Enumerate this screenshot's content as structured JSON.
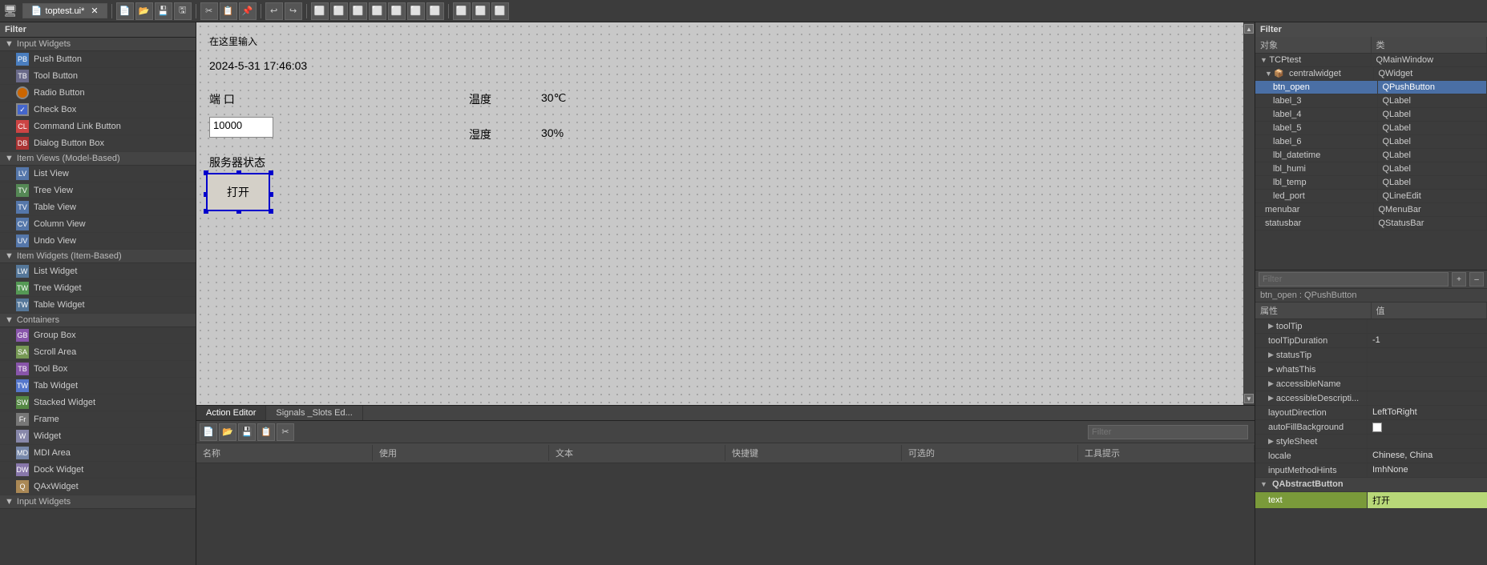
{
  "window": {
    "title": "toptest.ui*",
    "tab_label": "toptest.ui*"
  },
  "toolbar": {
    "buttons": [
      "new",
      "open",
      "save",
      "save-as",
      "cut",
      "copy",
      "paste",
      "undo",
      "redo",
      "align-left",
      "align-center",
      "align-right",
      "grid",
      "layout-h",
      "layout-v",
      "layout-grid",
      "form",
      "break-layout",
      "adjust-size",
      "tab-order",
      "buddies",
      "signals"
    ]
  },
  "left_panel": {
    "header": "Filter",
    "sections": [
      {
        "label": "Input Widgets",
        "items": [
          {
            "label": "Push Button",
            "icon": "btn"
          },
          {
            "label": "Tool Button",
            "icon": "tool"
          },
          {
            "label": "Radio Button",
            "icon": "radio"
          },
          {
            "label": "Check Box",
            "icon": "check"
          },
          {
            "label": "Command Link Button",
            "icon": "cmd"
          },
          {
            "label": "Dialog Button Box",
            "icon": "dialog"
          }
        ]
      },
      {
        "label": "Item Views (Model-Based)",
        "items": [
          {
            "label": "List View",
            "icon": "list"
          },
          {
            "label": "Tree View",
            "icon": "tree"
          },
          {
            "label": "Table View",
            "icon": "table"
          },
          {
            "label": "Column View",
            "icon": "col"
          },
          {
            "label": "Undo View",
            "icon": "undo"
          }
        ]
      },
      {
        "label": "Item Widgets (Item-Based)",
        "items": [
          {
            "label": "List Widget",
            "icon": "list"
          },
          {
            "label": "Tree Widget",
            "icon": "tree"
          },
          {
            "label": "Table Widget",
            "icon": "table"
          }
        ]
      },
      {
        "label": "Containers",
        "items": [
          {
            "label": "Group Box",
            "icon": "group"
          },
          {
            "label": "Scroll Area",
            "icon": "scroll"
          },
          {
            "label": "Tool Box",
            "icon": "toolbox"
          },
          {
            "label": "Tab Widget",
            "icon": "tab"
          },
          {
            "label": "Stacked Widget",
            "icon": "stacked"
          },
          {
            "label": "Frame",
            "icon": "frame"
          },
          {
            "label": "Widget",
            "icon": "widget"
          },
          {
            "label": "MDI Area",
            "icon": "mdi"
          },
          {
            "label": "Dock Widget",
            "icon": "dock"
          },
          {
            "label": "QAxWidget",
            "icon": "qax"
          }
        ]
      },
      {
        "label": "Input Widgets",
        "items": []
      }
    ]
  },
  "canvas": {
    "placeholder_text": "在这里输入",
    "datetime_text": "2024-5-31  17:46:03",
    "port_label": "端  口",
    "temp_label": "温度",
    "temp_value": "30℃",
    "humi_label": "湿度",
    "humi_value": "30%",
    "port_input": "10000",
    "server_label": "服务器状态",
    "btn_open_label": "打开"
  },
  "bottom_panel": {
    "tabs": [
      "Action Editor",
      "Signals _Slots Ed..."
    ],
    "active_tab": "Action Editor",
    "filter_placeholder": "Filter",
    "columns": [
      "名称",
      "使用",
      "文本",
      "快捷键",
      "可选的",
      "工具提示"
    ]
  },
  "right_object_tree": {
    "header": "Filter",
    "columns": [
      "对象",
      "类"
    ],
    "rows": [
      {
        "indent": 0,
        "expand": true,
        "name": "TCPtest",
        "cls": "QMainWindow",
        "selected": false
      },
      {
        "indent": 1,
        "expand": true,
        "name": "centralwidget",
        "cls": "QWidget",
        "selected": false
      },
      {
        "indent": 2,
        "expand": false,
        "name": "btn_open",
        "cls": "QPushButton",
        "selected": true
      },
      {
        "indent": 2,
        "expand": false,
        "name": "label_3",
        "cls": "QLabel",
        "selected": false
      },
      {
        "indent": 2,
        "expand": false,
        "name": "label_4",
        "cls": "QLabel",
        "selected": false
      },
      {
        "indent": 2,
        "expand": false,
        "name": "label_5",
        "cls": "QLabel",
        "selected": false
      },
      {
        "indent": 2,
        "expand": false,
        "name": "label_6",
        "cls": "QLabel",
        "selected": false
      },
      {
        "indent": 2,
        "expand": false,
        "name": "lbl_datetime",
        "cls": "QLabel",
        "selected": false
      },
      {
        "indent": 2,
        "expand": false,
        "name": "lbl_humi",
        "cls": "QLabel",
        "selected": false
      },
      {
        "indent": 2,
        "expand": false,
        "name": "lbl_temp",
        "cls": "QLabel",
        "selected": false
      },
      {
        "indent": 2,
        "expand": false,
        "name": "led_port",
        "cls": "QLineEdit",
        "selected": false
      },
      {
        "indent": 1,
        "expand": false,
        "name": "menubar",
        "cls": "QMenuBar",
        "selected": false
      },
      {
        "indent": 1,
        "expand": false,
        "name": "statusbar",
        "cls": "QStatusBar",
        "selected": false
      }
    ]
  },
  "right_props": {
    "filter_placeholder": "Filter",
    "context_label": "btn_open : QPushButton",
    "columns": [
      "属性",
      "值"
    ],
    "sections": [
      {
        "label": "",
        "rows": [
          {
            "key": "toolTip",
            "val": "",
            "indent": 1,
            "expand": true
          },
          {
            "key": "toolTipDuration",
            "val": "-1",
            "indent": 1,
            "expand": false
          },
          {
            "key": "statusTip",
            "val": "",
            "indent": 1,
            "expand": true
          },
          {
            "key": "whatsThis",
            "val": "",
            "indent": 1,
            "expand": true
          },
          {
            "key": "accessibleName",
            "val": "",
            "indent": 1,
            "expand": true
          },
          {
            "key": "accessibleDescripti...",
            "val": "",
            "indent": 1,
            "expand": true
          },
          {
            "key": "layoutDirection",
            "val": "LeftToRight",
            "indent": 1,
            "expand": false
          },
          {
            "key": "autoFillBackground",
            "val": "☐",
            "indent": 1,
            "expand": false
          },
          {
            "key": "styleSheet",
            "val": "",
            "indent": 1,
            "expand": true
          },
          {
            "key": "locale",
            "val": "Chinese, China",
            "indent": 1,
            "expand": false
          },
          {
            "key": "inputMethodHints",
            "val": "ImhNone",
            "indent": 1,
            "expand": false
          }
        ]
      },
      {
        "label": "QAbstractButton",
        "rows": [
          {
            "key": "text",
            "val": "打开",
            "indent": 1,
            "expand": false,
            "highlight": true
          }
        ]
      }
    ],
    "plus_btn": "+",
    "minus_btn": "–"
  }
}
